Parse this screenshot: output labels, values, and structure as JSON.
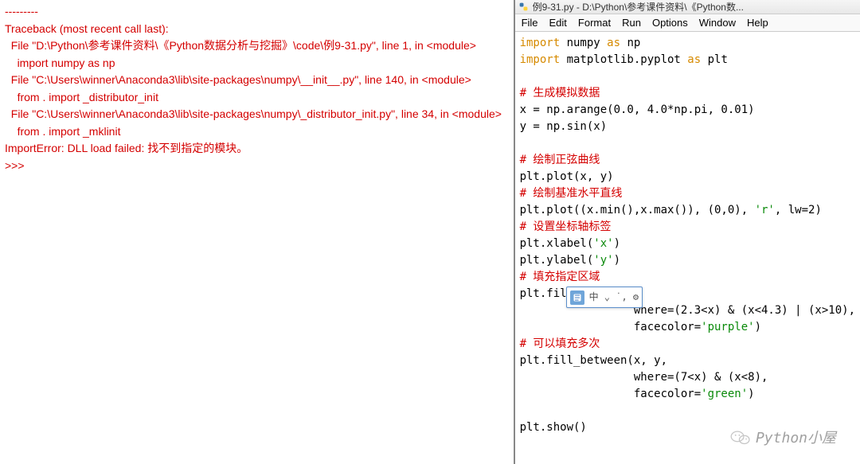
{
  "left": {
    "sep": "---------",
    "lines": [
      "Traceback (most recent call last):",
      "  File \"D:\\Python\\参考课件资料\\《Python数据分析与挖掘》\\code\\例9-31.py\", line 1, in <module>",
      "    import numpy as np",
      "  File \"C:\\Users\\winner\\Anaconda3\\lib\\site-packages\\numpy\\__init__.py\", line 140, in <module>",
      "    from . import _distributor_init",
      "  File \"C:\\Users\\winner\\Anaconda3\\lib\\site-packages\\numpy\\_distributor_init.py\", line 34, in <module>",
      "    from . import _mklinit",
      "ImportError: DLL load failed: 找不到指定的模块。",
      ">>>"
    ]
  },
  "right": {
    "title": "例9-31.py - D:\\Python\\参考课件资料\\《Python数...",
    "menu": {
      "file": "File",
      "edit": "Edit",
      "format": "Format",
      "run": "Run",
      "options": "Options",
      "window": "Window",
      "help": "Help"
    },
    "code": {
      "l1": {
        "import": "import",
        "mod": " numpy ",
        "as": "as",
        "alias": " np"
      },
      "l2": {
        "import": "import",
        "mod": " matplotlib.pyplot ",
        "as": "as",
        "alias": " plt"
      },
      "c1": "# 生成模拟数据",
      "l3": "x = np.arange(0.0, 4.0*np.pi, 0.01)",
      "l4": "y = np.sin(x)",
      "c2": "# 绘制正弦曲线",
      "l5": "plt.plot(x, y)",
      "c3": "# 绘制基准水平直线",
      "l6a": "plt.plot((x.min(),x.max()), (0,0), ",
      "l6b": "'r'",
      "l6c": ", lw=2)",
      "c4": "# 设置坐标轴标签",
      "l7a": "plt.xlabel(",
      "l7b": "'x'",
      "l7c": ")",
      "l8a": "plt.ylabel(",
      "l8b": "'y'",
      "l8c": ")",
      "c5": "# 填充指定区域",
      "l9": "plt.fill_b",
      "l10": "                 where=(2.3<x) & (x<4.3) | (x>10),",
      "l11a": "                 facecolor=",
      "l11b": "'purple'",
      "l11c": ")",
      "c6": "# 可以填充多次",
      "l12": "plt.fill_between(x, y,",
      "l13": "                 where=(7<x) & (x<8),",
      "l14a": "                 facecolor=",
      "l14b": "'green'",
      "l14c": ")",
      "l15": "plt.show()"
    },
    "ime": {
      "text": "中 ⌄ ˙, ⚙"
    },
    "watermark": "Python小屋"
  }
}
